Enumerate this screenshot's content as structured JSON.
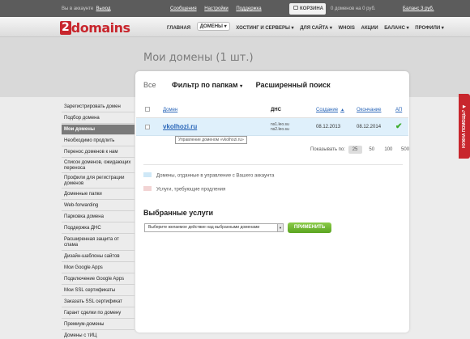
{
  "topbar": {
    "account_prefix": "Вы в аккаунте",
    "logout": "Выход",
    "links": [
      "Сообщения",
      "Настройки",
      "Поддержка"
    ],
    "cart": "КОРЗИНА",
    "cart_info": "0 доменов на 0 руб.",
    "balance": "Баланс 3 руб."
  },
  "logo": {
    "num": "2",
    "word": "domains"
  },
  "nav": [
    "ГЛАВНАЯ",
    "ДОМЕНЫ ▾",
    "ХОСТИНГ И СЕРВЕРЫ ▾",
    "ДЛЯ САЙТА ▾",
    "WHOIS",
    "АКЦИИ",
    "БАЛАНС ▾",
    "ПРОФИЛИ ▾"
  ],
  "page_title": "Мои домены (1 шт.)",
  "filters": {
    "all": "Все",
    "folders": "Фильтр по папкам",
    "caret": "▾",
    "advanced": "Расширенный поиск"
  },
  "table": {
    "headers": {
      "domain": "Домен",
      "dns": "ДНС",
      "created": "Создание",
      "created_arrow": "▲",
      "expires": "Окончание",
      "autorenew": "АП"
    },
    "rows": [
      {
        "domain": "vkolhozi.ru",
        "dns1": "ns1.leo.su",
        "dns2": "ns2.leo.su",
        "created": "08.12.2013",
        "expires": "08.12.2014",
        "autorenew": "✔"
      }
    ],
    "tooltip": "Управление доменом «vkolhozi.ru»"
  },
  "perpage": {
    "label": "Показывать по:",
    "options": [
      "25",
      "50",
      "100",
      "500"
    ]
  },
  "legend": [
    {
      "text": "Домены, отданные в управление с Вашего аккаунта",
      "color": "#cfe8f7"
    },
    {
      "text": "Услуги, требующие продления",
      "color": "#f2d4d4"
    }
  ],
  "services": {
    "title": "Выбранные услуги",
    "select": "Выберите желаемое действие над выбранными доменами",
    "apply": "ПРИМЕНИТЬ"
  },
  "sidebar": [
    "Зарегистрировать домен",
    "Подбор домена",
    "Мои домены",
    "Необходимо продлить",
    "Перенос доменов к нам",
    "Список доменов, ожидающих переноса",
    "Профили для регистрации доменов",
    "Доменные папки",
    "Web-forwarding",
    "Парковка домена",
    "Поддержка ДНС",
    "Расширенная защита от спама",
    "Дизайн-шаблоны сайтов",
    "Мои Google Apps",
    "Подключение Google Apps",
    "Мои SSL сертификаты",
    "Заказать SSL сертификат",
    "Гарант сделки по домену",
    "Премиум-домены",
    "Домены с тИЦ"
  ],
  "help_tab": "НУЖНА ПОМОЩЬ? ◀",
  "colors": {
    "brand": "#c8262d",
    "link": "#2a66b8",
    "row_highlight": "#dff0fb",
    "apply": "#6cb52f"
  }
}
